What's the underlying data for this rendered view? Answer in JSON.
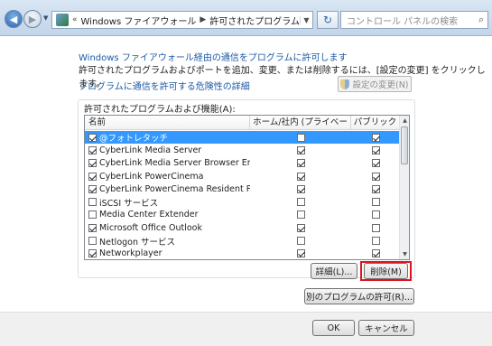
{
  "address": {
    "path_prefix": "«",
    "crumb1": "Windows ファイアウォール",
    "crumb2": "許可されたプログラム",
    "search_placeholder": "コントロール パネルの検索"
  },
  "intro": {
    "heading": "Windows ファイアウォール経由の通信をプログラムに許可します",
    "description": "許可されたプログラムおよびポートを追加、変更、または削除するには、[設定の変更] をクリックします。",
    "risk_link": "プログラムに通信を許可する危険性の詳細",
    "change_settings": "設定の変更(N)"
  },
  "list": {
    "title": "許可されたプログラムおよび機能(A):",
    "columns": [
      "名前",
      "ホーム/社内 (プライベート)",
      "パブリック"
    ],
    "rows": [
      {
        "name": "@フォトレタッチ",
        "enabled": true,
        "private": false,
        "public": true
      },
      {
        "name": "CyberLink Media Server",
        "enabled": true,
        "private": true,
        "public": true
      },
      {
        "name": "CyberLink Media Server Browser Engine",
        "enabled": true,
        "private": true,
        "public": true
      },
      {
        "name": "CyberLink PowerCinema",
        "enabled": true,
        "private": true,
        "public": true
      },
      {
        "name": "CyberLink PowerCinema Resident Program",
        "enabled": true,
        "private": true,
        "public": true
      },
      {
        "name": "iSCSI サービス",
        "enabled": false,
        "private": false,
        "public": false
      },
      {
        "name": "Media Center Extender",
        "enabled": false,
        "private": false,
        "public": false
      },
      {
        "name": "Microsoft Office Outlook",
        "enabled": true,
        "private": true,
        "public": false
      },
      {
        "name": "Netlogon サービス",
        "enabled": false,
        "private": false,
        "public": false
      },
      {
        "name": "Networkplayer",
        "enabled": true,
        "private": true,
        "public": true
      }
    ],
    "selected_index": 0
  },
  "buttons": {
    "details": "詳細(L)...",
    "remove": "削除(M)",
    "allow_other": "別のプログラムの許可(R)...",
    "ok": "OK",
    "cancel": "キャンセル"
  }
}
